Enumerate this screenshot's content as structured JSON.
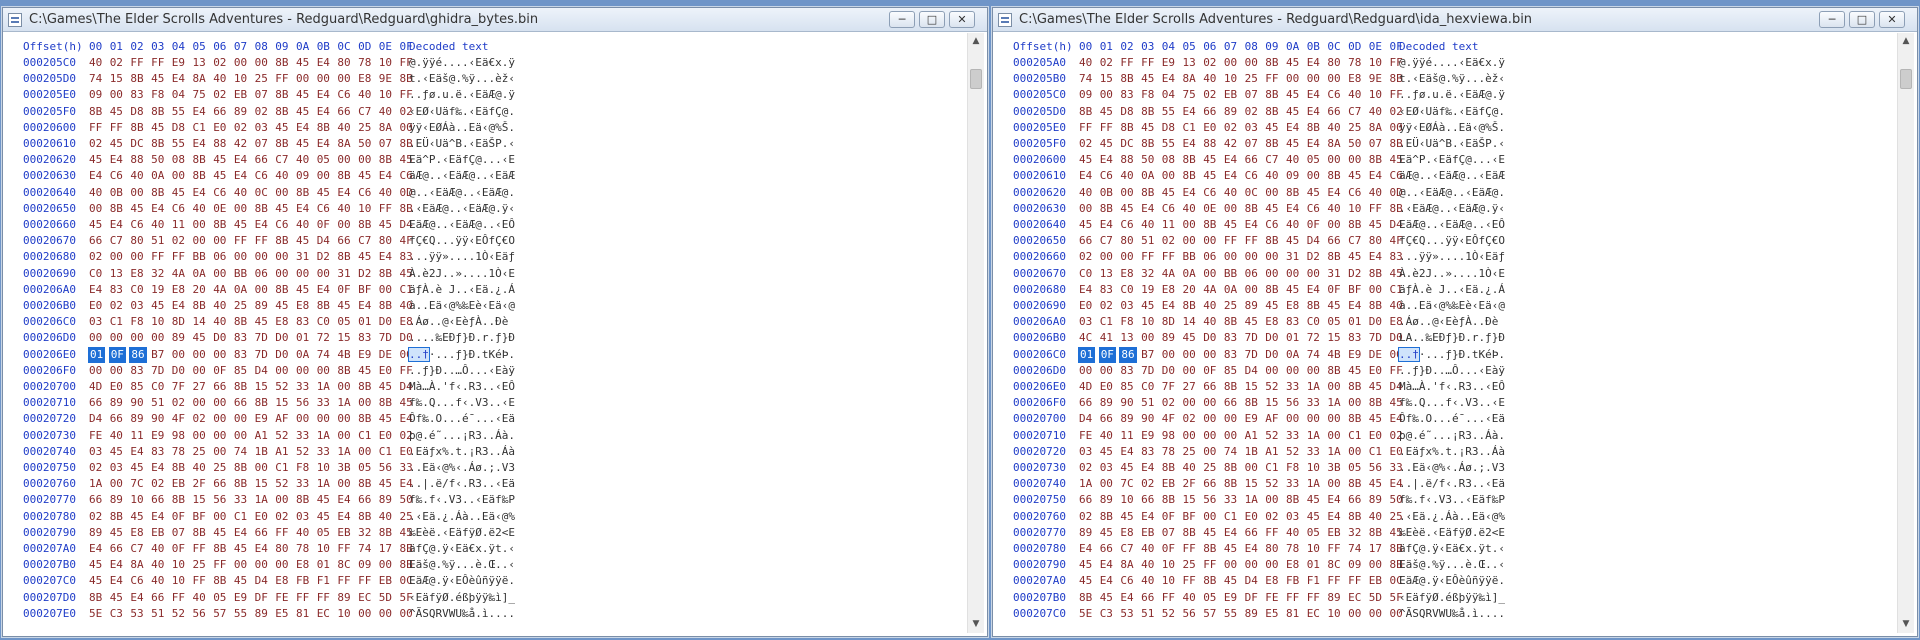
{
  "controls": {
    "minimize": "─",
    "maximize": "□",
    "close": "✕"
  },
  "icons": {
    "scroll_up": "▲",
    "scroll_down": "▼"
  },
  "colors": {
    "offset": "#1f3cc8",
    "hex": "#8a2a2a",
    "selection": "#1e6fd6"
  },
  "header": {
    "offset": "Offset(h)",
    "cols": [
      "00",
      "01",
      "02",
      "03",
      "04",
      "05",
      "06",
      "07",
      "08",
      "09",
      "0A",
      "0B",
      "0C",
      "0D",
      "0E",
      "0F"
    ],
    "decoded": "Decoded text"
  },
  "left": {
    "title": "C:\\Games\\The Elder Scrolls Adventures - Redguard\\Redguard\\ghidra_bytes.bin",
    "selected_row": 18,
    "selected_len": 3,
    "rows": [
      {
        "offset": "000205C0",
        "hex": "40 02 FF FF E9 13 02 00 00 8B 45 E4 80 78 10 FF",
        "text": "@.ÿÿé....‹Eä€x.ÿ"
      },
      {
        "offset": "000205D0",
        "hex": "74 15 8B 45 E4 8A 40 10 25 FF 00 00 00 E8 9E 8B",
        "text": "t.‹Eäš@.%ÿ...èž‹"
      },
      {
        "offset": "000205E0",
        "hex": "09 00 83 F8 04 75 02 EB 07 8B 45 E4 C6 40 10 FF",
        "text": "..ƒø.u.ë.‹EäÆ@.ÿ"
      },
      {
        "offset": "000205F0",
        "hex": "8B 45 D8 8B 55 E4 66 89 02 8B 45 E4 66 C7 40 02",
        "text": "‹EØ‹Uäf‰.‹EäfÇ@."
      },
      {
        "offset": "00020600",
        "hex": "FF FF 8B 45 D8 C1 E0 02 03 45 E4 8B 40 25 8A 00",
        "text": "ÿÿ‹EØÁà..Eä‹@%Š."
      },
      {
        "offset": "00020610",
        "hex": "02 45 DC 8B 55 E4 88 42 07 8B 45 E4 8A 50 07 8B",
        "text": ".EÜ‹Uä^B.‹EäŠP.‹"
      },
      {
        "offset": "00020620",
        "hex": "45 E4 88 50 08 8B 45 E4 66 C7 40 05 00 00 8B 45",
        "text": "Eä^P.‹EäfÇ@...‹E"
      },
      {
        "offset": "00020630",
        "hex": "E4 C6 40 0A 00 8B 45 E4 C6 40 09 00 8B 45 E4 C6",
        "text": "äÆ@..‹EäÆ@..‹EäÆ"
      },
      {
        "offset": "00020640",
        "hex": "40 0B 00 8B 45 E4 C6 40 0C 00 8B 45 E4 C6 40 0D",
        "text": "@..‹EäÆ@..‹EäÆ@."
      },
      {
        "offset": "00020650",
        "hex": "00 8B 45 E4 C6 40 0E 00 8B 45 E4 C6 40 10 FF 8B",
        "text": ".‹EäÆ@..‹EäÆ@.ÿ‹"
      },
      {
        "offset": "00020660",
        "hex": "45 E4 C6 40 11 00 8B 45 E4 C6 40 0F 00 8B 45 D4",
        "text": "EäÆ@..‹EäÆ@..‹EÔ"
      },
      {
        "offset": "00020670",
        "hex": "66 C7 80 51 02 00 00 FF FF 8B 45 D4 66 C7 80 4F",
        "text": "fÇ€Q...ÿÿ‹EÔfÇ€O"
      },
      {
        "offset": "00020680",
        "hex": "02 00 00 FF FF BB 06 00 00 00 31 D2 8B 45 E4 83",
        "text": "...ÿÿ»....1Ò‹Eäƒ"
      },
      {
        "offset": "00020690",
        "hex": "C0 13 E8 32 4A 0A 00 BB 06 00 00 00 31 D2 8B 45",
        "text": "À.è2J..»....1Ò‹E"
      },
      {
        "offset": "000206A0",
        "hex": "E4 83 C0 19 E8 20 4A 0A 00 8B 45 E4 0F BF 00 C1",
        "text": "äƒÀ.è J..‹Eä.¿.Á"
      },
      {
        "offset": "000206B0",
        "hex": "E0 02 03 45 E4 8B 40 25 89 45 E8 8B 45 E4 8B 40",
        "text": "à..Eä‹@%‰Eè‹Eä‹@"
      },
      {
        "offset": "000206C0",
        "hex": "03 C1 F8 10 8D 14 40 8B 45 E8 83 C0 05 01 D0 E8",
        "text": ".Áø..@‹EèƒÀ..Ðè"
      },
      {
        "offset": "000206D0",
        "hex": "00 00 00 00 89 45 D0 83 7D D0 01 72 15 83 7D D0",
        "text": "....‰EÐƒ}Ð.r.ƒ}Ð"
      },
      {
        "offset": "000206E0",
        "hex": "01 0F 86 B7 00 00 00 83 7D D0 0A 74 4B E9 DE 00",
        "text": "..†·...ƒ}Ð.tKéÞ."
      },
      {
        "offset": "000206F0",
        "hex": "00 00 83 7D D0 00 0F 85 D4 00 00 00 8B 45 E0 FF",
        "text": "..ƒ}Ð..…Ô...‹Eàÿ"
      },
      {
        "offset": "00020700",
        "hex": "4D E0 85 C0 7F 27 66 8B 15 52 33 1A 00 8B 45 D4",
        "text": "Mà…À.'f‹.R3..‹EÔ"
      },
      {
        "offset": "00020710",
        "hex": "66 89 90 51 02 00 00 66 8B 15 56 33 1A 00 8B 45",
        "text": "f‰.Q...f‹.V3..‹E"
      },
      {
        "offset": "00020720",
        "hex": "D4 66 89 90 4F 02 00 00 E9 AF 00 00 00 8B 45 E4",
        "text": "Ôf‰.O...é¯...‹Eä"
      },
      {
        "offset": "00020730",
        "hex": "FE 40 11 E9 98 00 00 00 A1 52 33 1A 00 C1 E0 02",
        "text": "þ@.é˜...¡R3..Áà."
      },
      {
        "offset": "00020740",
        "hex": "03 45 E4 83 78 25 00 74 1B A1 52 33 1A 00 C1 E0",
        "text": ".Eäƒx%.t.¡R3..Áà"
      },
      {
        "offset": "00020750",
        "hex": "02 03 45 E4 8B 40 25 8B 00 C1 F8 10 3B 05 56 33",
        "text": "..Eä‹@%‹.Áø.;.V3"
      },
      {
        "offset": "00020760",
        "hex": "1A 00 7C 02 EB 2F 66 8B 15 52 33 1A 00 8B 45 E4",
        "text": "..|.ë/f‹.R3..‹Eä"
      },
      {
        "offset": "00020770",
        "hex": "66 89 10 66 8B 15 56 33 1A 00 8B 45 E4 66 89 50",
        "text": "f‰.f‹.V3..‹Eäf‰P"
      },
      {
        "offset": "00020780",
        "hex": "02 8B 45 E4 0F BF 00 C1 E0 02 03 45 E4 8B 40 25",
        "text": ".‹Eä.¿.Áà..Eä‹@%"
      },
      {
        "offset": "00020790",
        "hex": "89 45 E8 EB 07 8B 45 E4 66 FF 40 05 EB 32 8B 45",
        "text": "‰Eèë.‹EäfÿØ.ë2<E"
      },
      {
        "offset": "000207A0",
        "hex": "E4 66 C7 40 0F FF 8B 45 E4 80 78 10 FF 74 17 8B",
        "text": "äfÇ@.ÿ‹Eä€x.ÿt.‹"
      },
      {
        "offset": "000207B0",
        "hex": "45 E4 8A 40 10 25 FF 00 00 00 E8 01 8C 09 00 8B",
        "text": "Eäš@.%ÿ...è.Œ..‹"
      },
      {
        "offset": "000207C0",
        "hex": "45 E4 C6 40 10 FF 8B 45 D4 E8 FB F1 FF FF EB 0C",
        "text": "EäÆ@.ÿ‹EÔèûñÿÿë."
      },
      {
        "offset": "000207D0",
        "hex": "8B 45 E4 66 FF 40 05 E9 DF FE FF FF 89 EC 5D 5F",
        "text": "‹EäfÿØ.éßþÿÿ‰ì]_"
      },
      {
        "offset": "000207E0",
        "hex": "5E C3 53 51 52 56 57 55 89 E5 81 EC 10 00 00 00",
        "text": "^ÃSQRVWU‰å.ì...."
      }
    ]
  },
  "right": {
    "title": "C:\\Games\\The Elder Scrolls Adventures - Redguard\\Redguard\\ida_hexviewa.bin",
    "selected_row": 18,
    "selected_len": 3,
    "rows": [
      {
        "offset": "000205A0",
        "hex": "40 02 FF FF E9 13 02 00 00 8B 45 E4 80 78 10 FF",
        "text": "@.ÿÿé....‹Eä€x.ÿ"
      },
      {
        "offset": "000205B0",
        "hex": "74 15 8B 45 E4 8A 40 10 25 FF 00 00 00 E8 9E 8B",
        "text": "t.‹Eäš@.%ÿ...èž‹"
      },
      {
        "offset": "000205C0",
        "hex": "09 00 83 F8 04 75 02 EB 07 8B 45 E4 C6 40 10 FF",
        "text": "..ƒø.u.ë.‹EäÆ@.ÿ"
      },
      {
        "offset": "000205D0",
        "hex": "8B 45 D8 8B 55 E4 66 89 02 8B 45 E4 66 C7 40 02",
        "text": "‹EØ‹Uäf‰.‹EäfÇ@."
      },
      {
        "offset": "000205E0",
        "hex": "FF FF 8B 45 D8 C1 E0 02 03 45 E4 8B 40 25 8A 00",
        "text": "ÿÿ‹EØÁà..Eä‹@%Š."
      },
      {
        "offset": "000205F0",
        "hex": "02 45 DC 8B 55 E4 88 42 07 8B 45 E4 8A 50 07 8B",
        "text": ".EÜ‹Uä^B.‹EäŠP.‹"
      },
      {
        "offset": "00020600",
        "hex": "45 E4 88 50 08 8B 45 E4 66 C7 40 05 00 00 8B 45",
        "text": "Eä^P.‹EäfÇ@...‹E"
      },
      {
        "offset": "00020610",
        "hex": "E4 C6 40 0A 00 8B 45 E4 C6 40 09 00 8B 45 E4 C6",
        "text": "äÆ@..‹EäÆ@..‹EäÆ"
      },
      {
        "offset": "00020620",
        "hex": "40 0B 00 8B 45 E4 C6 40 0C 00 8B 45 E4 C6 40 0D",
        "text": "@..‹EäÆ@..‹EäÆ@."
      },
      {
        "offset": "00020630",
        "hex": "00 8B 45 E4 C6 40 0E 00 8B 45 E4 C6 40 10 FF 8B",
        "text": ".‹EäÆ@..‹EäÆ@.ÿ‹"
      },
      {
        "offset": "00020640",
        "hex": "45 E4 C6 40 11 00 8B 45 E4 C6 40 0F 00 8B 45 D4",
        "text": "EäÆ@..‹EäÆ@..‹EÔ"
      },
      {
        "offset": "00020650",
        "hex": "66 C7 80 51 02 00 00 FF FF 8B 45 D4 66 C7 80 4F",
        "text": "fÇ€Q...ÿÿ‹EÔfÇ€O"
      },
      {
        "offset": "00020660",
        "hex": "02 00 00 FF FF BB 06 00 00 00 31 D2 8B 45 E4 83",
        "text": "...ÿÿ»....1Ò‹Eäƒ"
      },
      {
        "offset": "00020670",
        "hex": "C0 13 E8 32 4A 0A 00 BB 06 00 00 00 31 D2 8B 45",
        "text": "À.è2J..»....1Ò‹E"
      },
      {
        "offset": "00020680",
        "hex": "E4 83 C0 19 E8 20 4A 0A 00 8B 45 E4 0F BF 00 C1",
        "text": "äƒÀ.è J..‹Eä.¿.Á"
      },
      {
        "offset": "00020690",
        "hex": "E0 02 03 45 E4 8B 40 25 89 45 E8 8B 45 E4 8B 40",
        "text": "à..Eä‹@%‰Eè‹Eä‹@"
      },
      {
        "offset": "000206A0",
        "hex": "03 C1 F8 10 8D 14 40 8B 45 E8 83 C0 05 01 D0 E8",
        "text": ".Áø..@‹EèƒÀ..Ðè"
      },
      {
        "offset": "000206B0",
        "hex": "4C 41 13 00 89 45 D0 83 7D D0 01 72 15 83 7D D0",
        "text": "LA..‰EÐƒ}Ð.r.ƒ}Ð"
      },
      {
        "offset": "000206C0",
        "hex": "01 0F 86 B7 00 00 00 83 7D D0 0A 74 4B E9 DE 00",
        "text": "..†·...ƒ}Ð.tKéÞ."
      },
      {
        "offset": "000206D0",
        "hex": "00 00 83 7D D0 00 0F 85 D4 00 00 00 8B 45 E0 FF",
        "text": "..ƒ}Ð..…Ô...‹Eàÿ"
      },
      {
        "offset": "000206E0",
        "hex": "4D E0 85 C0 7F 27 66 8B 15 52 33 1A 00 8B 45 D4",
        "text": "Mà…À.'f‹.R3..‹EÔ"
      },
      {
        "offset": "000206F0",
        "hex": "66 89 90 51 02 00 00 66 8B 15 56 33 1A 00 8B 45",
        "text": "f‰.Q...f‹.V3..‹E"
      },
      {
        "offset": "00020700",
        "hex": "D4 66 89 90 4F 02 00 00 E9 AF 00 00 00 8B 45 E4",
        "text": "Ôf‰.O...é¯...‹Eä"
      },
      {
        "offset": "00020710",
        "hex": "FE 40 11 E9 98 00 00 00 A1 52 33 1A 00 C1 E0 02",
        "text": "þ@.é˜...¡R3..Áà."
      },
      {
        "offset": "00020720",
        "hex": "03 45 E4 83 78 25 00 74 1B A1 52 33 1A 00 C1 E0",
        "text": ".Eäƒx%.t.¡R3..Áà"
      },
      {
        "offset": "00020730",
        "hex": "02 03 45 E4 8B 40 25 8B 00 C1 F8 10 3B 05 56 33",
        "text": "..Eä‹@%‹.Áø.;.V3"
      },
      {
        "offset": "00020740",
        "hex": "1A 00 7C 02 EB 2F 66 8B 15 52 33 1A 00 8B 45 E4",
        "text": "..|.ë/f‹.R3..‹Eä"
      },
      {
        "offset": "00020750",
        "hex": "66 89 10 66 8B 15 56 33 1A 00 8B 45 E4 66 89 50",
        "text": "f‰.f‹.V3..‹Eäf‰P"
      },
      {
        "offset": "00020760",
        "hex": "02 8B 45 E4 0F BF 00 C1 E0 02 03 45 E4 8B 40 25",
        "text": ".‹Eä.¿.Áà..Eä‹@%"
      },
      {
        "offset": "00020770",
        "hex": "89 45 E8 EB 07 8B 45 E4 66 FF 40 05 EB 32 8B 45",
        "text": "‰Eèë.‹EäfÿØ.ë2<E"
      },
      {
        "offset": "00020780",
        "hex": "E4 66 C7 40 0F FF 8B 45 E4 80 78 10 FF 74 17 8B",
        "text": "äfÇ@.ÿ‹Eä€x.ÿt.‹"
      },
      {
        "offset": "00020790",
        "hex": "45 E4 8A 40 10 25 FF 00 00 00 E8 01 8C 09 00 8B",
        "text": "Eäš@.%ÿ...è.Œ..‹"
      },
      {
        "offset": "000207A0",
        "hex": "45 E4 C6 40 10 FF 8B 45 D4 E8 FB F1 FF FF EB 0C",
        "text": "EäÆ@.ÿ‹EÔèûñÿÿë."
      },
      {
        "offset": "000207B0",
        "hex": "8B 45 E4 66 FF 40 05 E9 DF FE FF FF 89 EC 5D 5F",
        "text": "‹EäfÿØ.éßþÿÿ‰ì]_"
      },
      {
        "offset": "000207C0",
        "hex": "5E C3 53 51 52 56 57 55 89 E5 81 EC 10 00 00 00",
        "text": "^ÃSQRVWU‰å.ì...."
      }
    ]
  }
}
